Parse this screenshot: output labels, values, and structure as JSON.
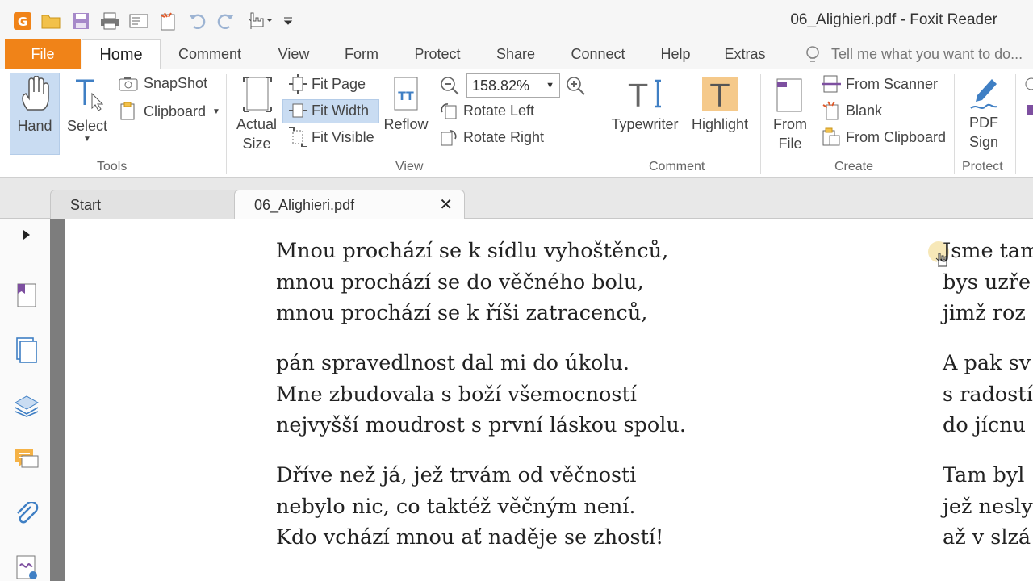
{
  "window": {
    "title": "06_Alighieri.pdf - Foxit Reader"
  },
  "quick_access": [
    "app-icon",
    "open-icon",
    "save-icon",
    "print-icon",
    "email-icon",
    "new-icon",
    "undo-icon",
    "redo-icon",
    "hand-touch-icon",
    "customize-icon"
  ],
  "ribbon_tabs": [
    {
      "label": "File"
    },
    {
      "label": "Home"
    },
    {
      "label": "Comment"
    },
    {
      "label": "View"
    },
    {
      "label": "Form"
    },
    {
      "label": "Protect"
    },
    {
      "label": "Share"
    },
    {
      "label": "Connect"
    },
    {
      "label": "Help"
    },
    {
      "label": "Extras"
    }
  ],
  "tell_me": {
    "placeholder": "Tell me what you want to do..."
  },
  "ribbon": {
    "tools": {
      "label": "Tools",
      "hand": "Hand",
      "select": "Select",
      "snapshot": "SnapShot",
      "clipboard": "Clipboard"
    },
    "view": {
      "label": "View",
      "actual_size_1": "Actual",
      "actual_size_2": "Size",
      "fit_page": "Fit Page",
      "fit_width": "Fit Width",
      "fit_visible": "Fit Visible",
      "reflow": "Reflow",
      "zoom": "158.82%",
      "rotate_left": "Rotate Left",
      "rotate_right": "Rotate Right"
    },
    "comment": {
      "label": "Comment",
      "typewriter": "Typewriter",
      "highlight": "Highlight"
    },
    "create": {
      "label": "Create",
      "from_file_1": "From",
      "from_file_2": "File",
      "from_scanner": "From Scanner",
      "blank": "Blank",
      "from_clipboard": "From Clipboard"
    },
    "protect": {
      "label": "Protect",
      "pdf_sign_1": "PDF",
      "pdf_sign_2": "Sign"
    }
  },
  "doc_tabs": [
    {
      "label": "Start"
    },
    {
      "label": "06_Alighieri.pdf"
    }
  ],
  "colors": {
    "accent": "#f08318",
    "selection": "#c9dcf2"
  },
  "document": {
    "left_column": [
      [
        "Mnou prochází se k sídlu vyhoštěnců,",
        "mnou prochází se do věčného bolu,",
        "mnou prochází se k říši zatracenců,"
      ],
      [
        "pán spravedlnost dal mi do úkolu.",
        "Mne zbudovala s boží všemocností",
        "nejvyšší moudrost s první láskou spolu."
      ],
      [
        "Dříve než já, jež trvám od věčnosti",
        "nebylo nic, co taktéž věčným není.",
        "Kdo vchází mnou ať naděje se zhostí!"
      ]
    ],
    "right_column": [
      [
        "Jsme tam",
        "bys uzře",
        "jimž roz"
      ],
      [
        "A pak sv",
        "s radostí",
        "do jícnu"
      ],
      [
        "Tam byl",
        "jež nesly",
        "až v slzá"
      ]
    ]
  }
}
